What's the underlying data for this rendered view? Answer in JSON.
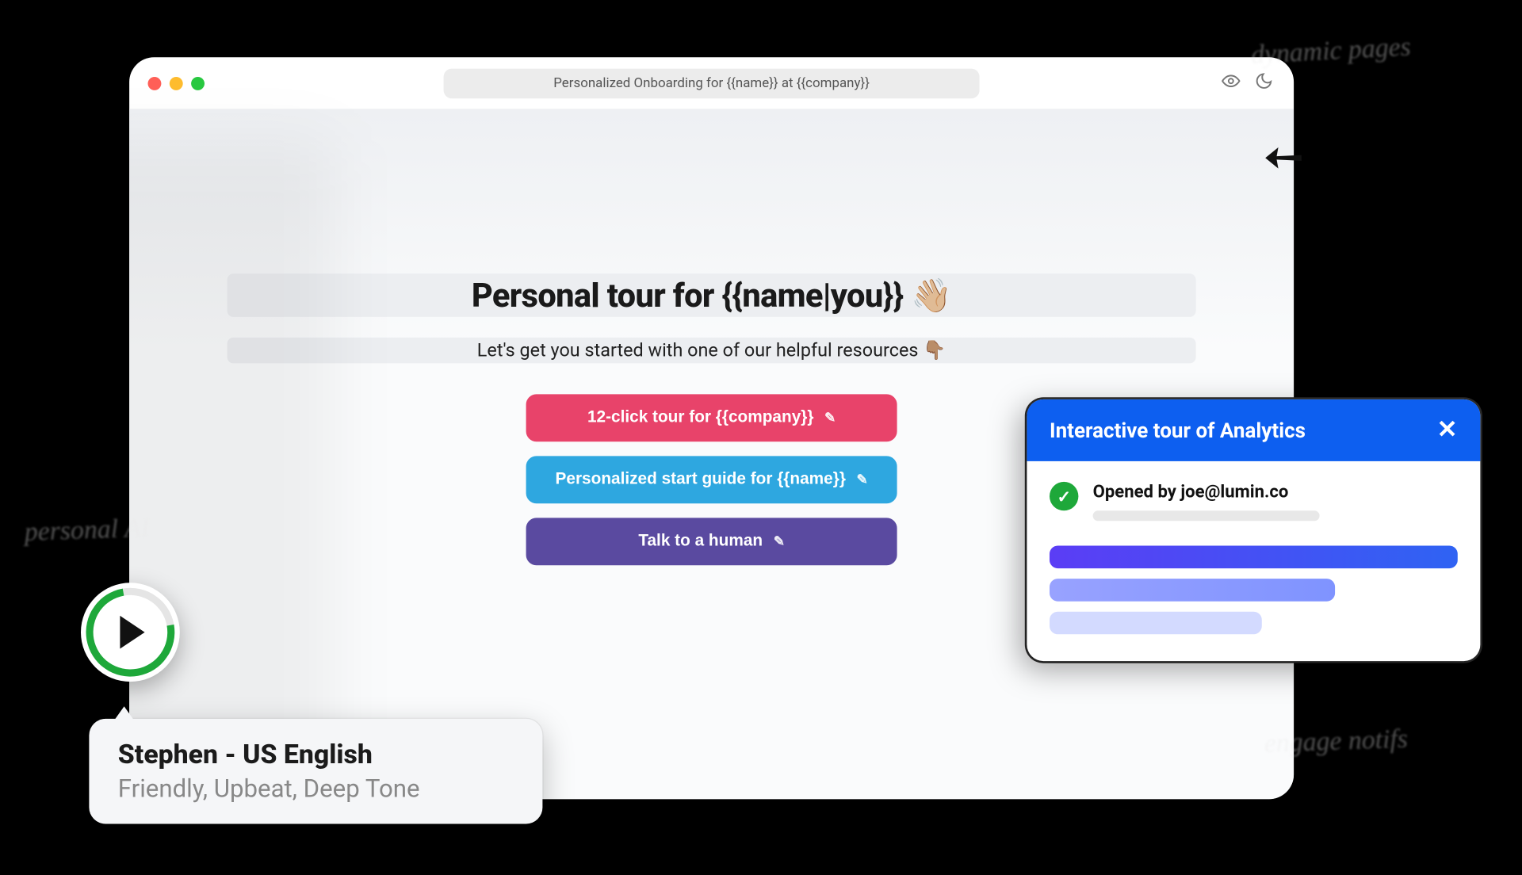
{
  "browser": {
    "url": "Personalized Onboarding for {{name}} at {{company}}"
  },
  "hero": {
    "headline": "Personal tour for {{name|you}} 👋🏼",
    "subline": "Let's get you started with one of our helpful resources 👇🏽",
    "cta_pink": "12-click tour for {{company}}",
    "cta_blue": "Personalized start guide for {{name}}",
    "cta_purple": "Talk to a human"
  },
  "voice": {
    "name": "Stephen - US English",
    "desc": "Friendly, Upbeat, Deep Tone"
  },
  "notification": {
    "title": "Interactive tour of Analytics",
    "event_prefix": "Opened by ",
    "event_email": "joe@lumin.co"
  },
  "annotations": {
    "top": "dynamic pages",
    "left": "personal AI",
    "bottom": "engage notifs"
  }
}
